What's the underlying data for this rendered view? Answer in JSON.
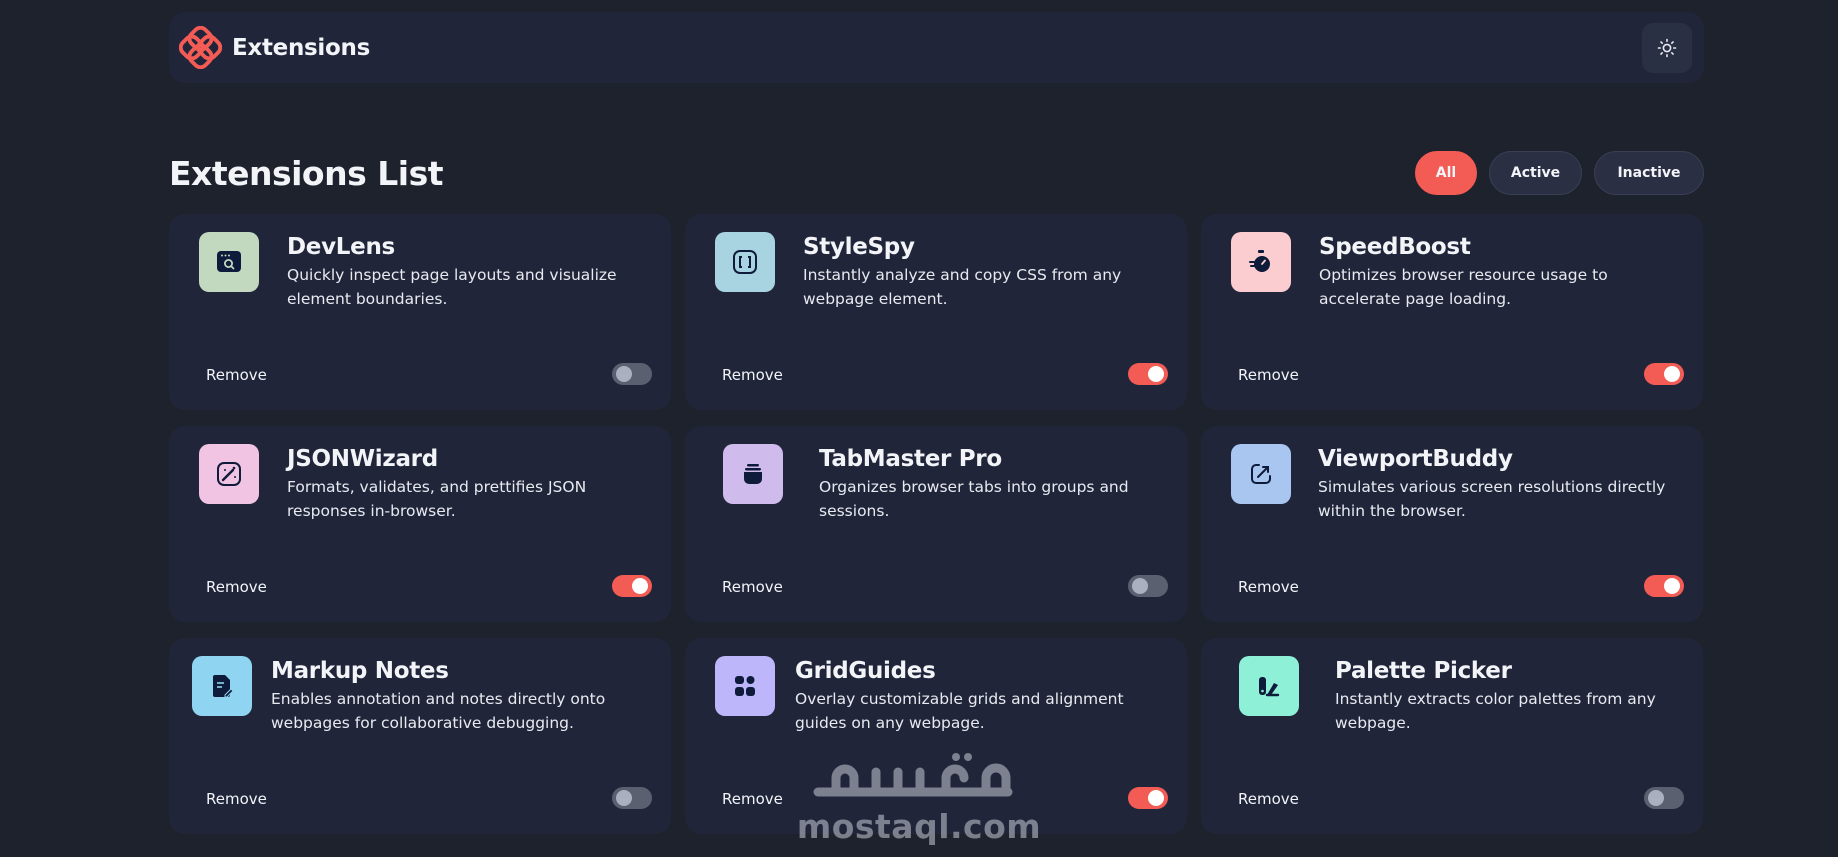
{
  "header": {
    "title": "Extensions",
    "logo_icon": "extensions-logo-icon",
    "theme_icon": "sun-icon"
  },
  "list": {
    "title": "Extensions List",
    "filters": [
      {
        "label": "All",
        "selected": true
      },
      {
        "label": "Active",
        "selected": false
      },
      {
        "label": "Inactive",
        "selected": false
      }
    ]
  },
  "extensions": [
    {
      "name": "DevLens",
      "description": "Quickly inspect page layouts and visualize element boundaries.",
      "remove_label": "Remove",
      "enabled": false,
      "icon": "inspect-icon",
      "icon_bg": "#c2d8bf"
    },
    {
      "name": "StyleSpy",
      "description": "Instantly analyze and copy CSS from any webpage element.",
      "remove_label": "Remove",
      "enabled": true,
      "icon": "css-brackets-icon",
      "icon_bg": "#a8d4e2"
    },
    {
      "name": "SpeedBoost",
      "description": "Optimizes browser resource usage to accelerate page loading.",
      "remove_label": "Remove",
      "enabled": true,
      "icon": "stopwatch-icon",
      "icon_bg": "#fccdd0"
    },
    {
      "name": "JSONWizard",
      "description": "Formats, validates, and prettifies JSON responses in-browser.",
      "remove_label": "Remove",
      "enabled": true,
      "icon": "magic-wand-icon",
      "icon_bg": "#f0c4e2"
    },
    {
      "name": "TabMaster Pro",
      "description": "Organizes browser tabs into groups and sessions.",
      "remove_label": "Remove",
      "enabled": false,
      "icon": "tab-stack-icon",
      "icon_bg": "#cfbcec"
    },
    {
      "name": "ViewportBuddy",
      "description": "Simulates various screen resolutions directly within the browser.",
      "remove_label": "Remove",
      "enabled": true,
      "icon": "resize-icon",
      "icon_bg": "#a9c6f0"
    },
    {
      "name": "Markup Notes",
      "description": "Enables annotation and notes directly onto webpages for collaborative debugging.",
      "remove_label": "Remove",
      "enabled": false,
      "icon": "note-pen-icon",
      "icon_bg": "#8fd4f0"
    },
    {
      "name": "GridGuides",
      "description": "Overlay customizable grids and alignment guides on any webpage.",
      "remove_label": "Remove",
      "enabled": true,
      "icon": "grid-layout-icon",
      "icon_bg": "#bdb6fa"
    },
    {
      "name": "Palette Picker",
      "description": "Instantly extracts color palettes from any webpage.",
      "remove_label": "Remove",
      "enabled": false,
      "icon": "palette-icon",
      "icon_bg": "#8ff0d8"
    }
  ],
  "watermark": {
    "text": "mostaql.com"
  },
  "colors": {
    "accent": "#f25c54",
    "background": "#1d222c",
    "card": "#20253a"
  }
}
